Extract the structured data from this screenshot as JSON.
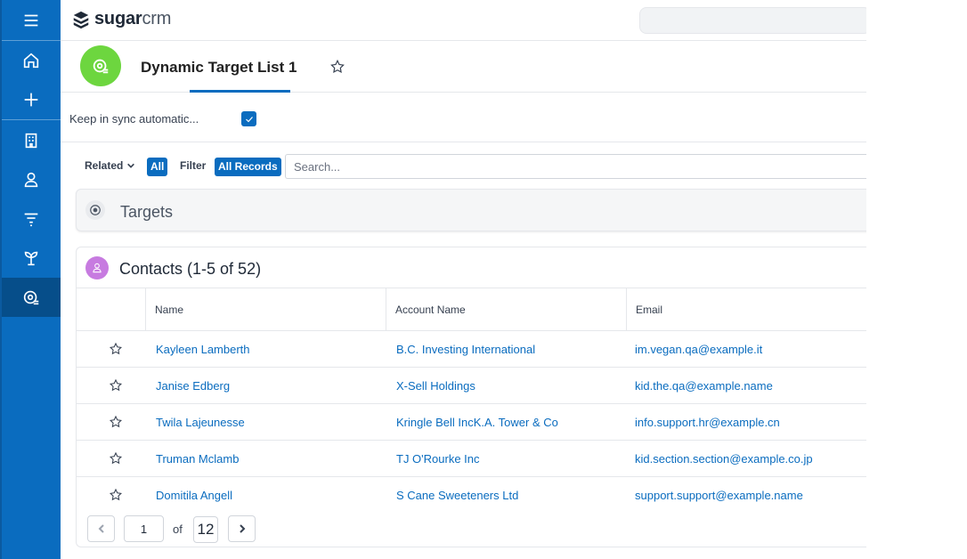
{
  "brand": {
    "name_bold": "sugar",
    "name_light": "crm"
  },
  "record": {
    "title": "Dynamic Target List 1"
  },
  "sync": {
    "label": "Keep in sync automatic..."
  },
  "filter_bar": {
    "related_label": "Related",
    "all_label": "All",
    "filter_label": "Filter",
    "all_records_label": "All Records",
    "search_placeholder": "Search..."
  },
  "targets_panel": {
    "title": "Targets"
  },
  "contacts_panel": {
    "title": "Contacts (1-5 of 52)",
    "columns": [
      "Name",
      "Account Name",
      "Email"
    ],
    "rows": [
      {
        "name": "Kayleen Lamberth",
        "account": "B.C. Investing International",
        "email": "im.vegan.qa@example.it"
      },
      {
        "name": "Janise Edberg",
        "account": "X-Sell Holdings",
        "email": "kid.the.qa@example.name"
      },
      {
        "name": "Twila Lajeunesse",
        "account": "Kringle Bell IncK.A. Tower & Co",
        "email": "info.support.hr@example.cn"
      },
      {
        "name": "Truman Mclamb",
        "account": "TJ O'Rourke Inc",
        "email": "kid.section.section@example.co.jp"
      },
      {
        "name": "Domitila Angell",
        "account": "S Cane Sweeteners Ltd",
        "email": "support.support@example.name"
      }
    ]
  },
  "pagination": {
    "current_page": "1",
    "of_label": "of",
    "total_pages": "12"
  },
  "colors": {
    "sidebar": "#0a6cbf",
    "sidebar_active": "#064e8a",
    "module_target_list": "#6dd63f",
    "module_contacts": "#c77be0",
    "link": "#0a6cbf"
  },
  "icons": {
    "sidebar": [
      "menu-icon",
      "home-icon",
      "plus-icon",
      "building-icon",
      "person-icon",
      "filter-icon",
      "plant-icon",
      "target-list-icon"
    ],
    "record_avatar": "target-list-icon",
    "favorite": "star-outline-icon"
  }
}
